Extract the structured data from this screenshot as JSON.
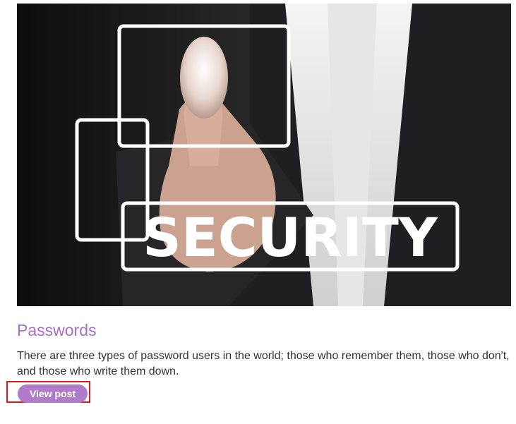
{
  "post": {
    "image_text": "SECURITY",
    "title": "Passwords",
    "excerpt": "There are three types of password users in the world; those who remember them, those who don't, and those who write them down.",
    "button_label": "View post"
  },
  "colors": {
    "title": "#a86ec4",
    "button": "#b07bc8",
    "highlight": "#e0191c",
    "text": "#333333"
  }
}
